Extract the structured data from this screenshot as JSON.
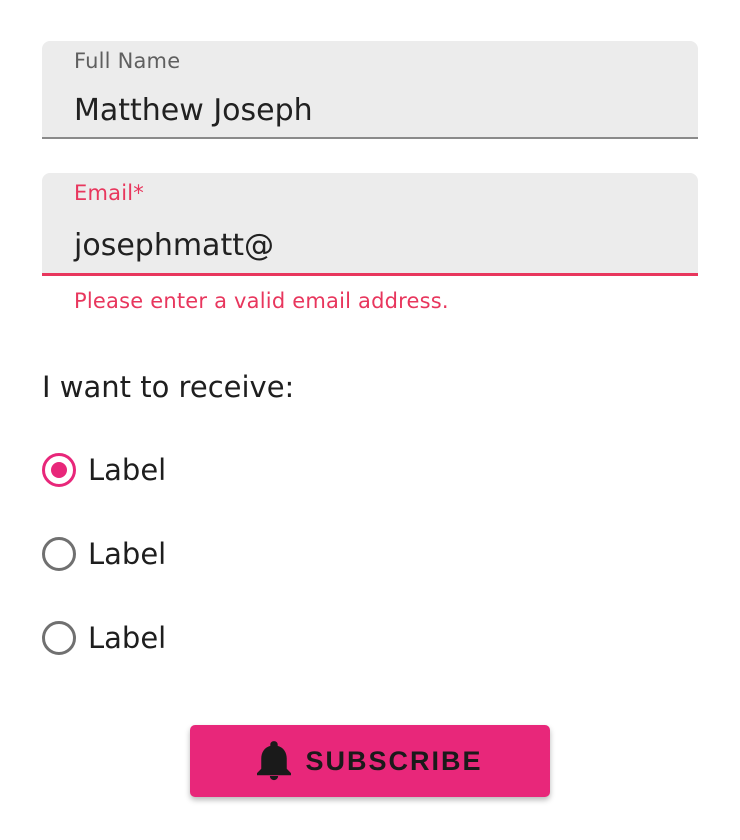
{
  "form": {
    "full_name": {
      "label": "Full Name",
      "value": "Matthew Joseph"
    },
    "email": {
      "label": "Email*",
      "value": "josephmatt@",
      "error": "Please enter a valid email address."
    },
    "receive_group": {
      "label": "I want to receive:",
      "options": [
        {
          "label": "Label",
          "checked": true
        },
        {
          "label": "Label",
          "checked": false
        },
        {
          "label": "Label",
          "checked": false
        }
      ]
    },
    "subscribe_button": {
      "label": "SUBSCRIBE",
      "icon": "bell-icon"
    }
  },
  "colors": {
    "accent": "#e8277a",
    "error": "#e8365d",
    "field_bg": "#ececec"
  }
}
